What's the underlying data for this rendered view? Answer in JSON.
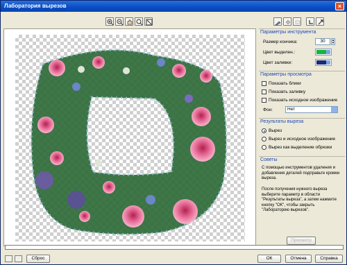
{
  "window": {
    "title": "Лаборатория вырезов"
  },
  "toolbar_left": [
    {
      "name": "zoom-in-icon"
    },
    {
      "name": "zoom-out-icon"
    },
    {
      "name": "hand-tool-icon"
    },
    {
      "name": "zoom-fit-icon"
    },
    {
      "name": "zoom-actual-icon"
    }
  ],
  "toolbar_right": [
    {
      "name": "cutout-brush-icon"
    },
    {
      "name": "fill-tool-icon"
    },
    {
      "name": "eraser-icon"
    },
    {
      "name": "undo-icon"
    },
    {
      "name": "redo-icon"
    }
  ],
  "tool_params": {
    "header": "Параметры инструмента",
    "tip_size_label": "Размер кончика:",
    "tip_size_value": "30",
    "highlight_color_label": "Цвет выделен.:",
    "highlight_color": "#19b33b",
    "fill_color_label": "Цвет заливки:",
    "fill_color": "#1d2a74"
  },
  "view_params": {
    "header": "Параметры просмотра",
    "show_highlight": "Показать блики",
    "show_fill": "Показать заливку",
    "show_original": "Показать исходное изображение",
    "background_label": "Фон:",
    "background_value": "Нет"
  },
  "cut_result": {
    "header": "Результаты выреза",
    "options": [
      "Вырез",
      "Вырез и исходное изображение",
      "Вырез как выделение обрезки"
    ],
    "selected_index": 0
  },
  "tips": {
    "header": "Советы",
    "text1": "С помощью инструментов удаления и добавления деталей подправьте кромки выреза.",
    "text2": "После получения нужного выреза выберите параметр в области \"Результаты выреза\", а затем нажмите кнопку \"ОК\", чтобы закрыть \"Лабораторию вырезов\"."
  },
  "buttons": {
    "preview": "Просмотр",
    "reset": "Сброс",
    "ok": "ОК",
    "cancel": "Отмена",
    "help": "Справка"
  },
  "colors": {
    "accent": "#1d4bb3",
    "title_bar": "#0a4fc6"
  }
}
